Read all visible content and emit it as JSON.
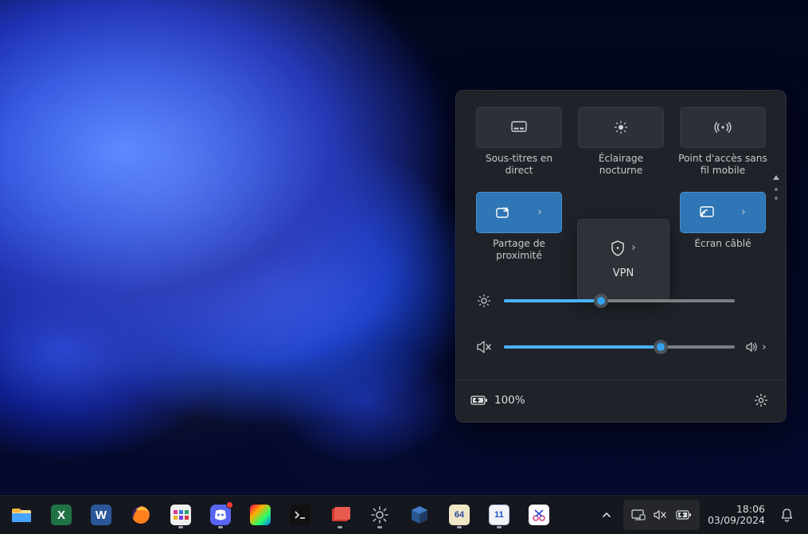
{
  "quick_settings": {
    "row1": [
      {
        "name": "live-captions",
        "label": "Sous-titres en direct",
        "active": false
      },
      {
        "name": "night-light",
        "label": "Éclairage nocturne",
        "active": false
      },
      {
        "name": "mobile-hotspot",
        "label": "Point d'accès sans fil mobile",
        "active": false
      }
    ],
    "row2": [
      {
        "name": "nearby-sharing",
        "label": "Partage de proximité",
        "active": true,
        "chevron": true
      },
      {
        "name": "vpn",
        "label": "VPN",
        "active": false,
        "chevron": true
      },
      {
        "name": "cast",
        "label": "Écran câblé",
        "active": true,
        "chevron": true
      }
    ],
    "brightness_percent": 42,
    "volume_percent": 68,
    "volume_muted": true,
    "battery_percent_text": "100%"
  },
  "taskbar": {
    "apps": [
      {
        "name": "file-explorer",
        "letter": "",
        "bg": "#f3c14b",
        "running": false
      },
      {
        "name": "excel",
        "letter": "X",
        "bg": "#1f7244",
        "running": false
      },
      {
        "name": "word",
        "letter": "W",
        "bg": "#2b579a",
        "running": false
      },
      {
        "name": "firefox",
        "letter": "",
        "bg": "#ff7139",
        "running": false
      },
      {
        "name": "app-purple",
        "letter": "",
        "bg": "#6a1b9a",
        "running": true
      },
      {
        "name": "discord",
        "letter": "",
        "bg": "#5865f2",
        "running": true,
        "badge": true
      },
      {
        "name": "app-color",
        "letter": "",
        "bg": "linear",
        "running": false
      },
      {
        "name": "terminal",
        "letter": "",
        "bg": "#222",
        "running": false
      },
      {
        "name": "app-red",
        "letter": "",
        "bg": "#d23a2f",
        "running": true
      },
      {
        "name": "settings",
        "letter": "",
        "bg": "#2f333a",
        "running": true
      },
      {
        "name": "virtualbox",
        "letter": "",
        "bg": "#2d3a5a",
        "running": false
      },
      {
        "name": "app-64",
        "letter": "64",
        "bg": "#e9e1c8",
        "running": true
      },
      {
        "name": "app-11",
        "letter": "11",
        "bg": "#eceff3",
        "running": true
      },
      {
        "name": "snipping-tool",
        "letter": "",
        "bg": "#ffffff",
        "running": false
      }
    ],
    "clock_time": "18:06",
    "clock_date": "03/09/2024"
  }
}
